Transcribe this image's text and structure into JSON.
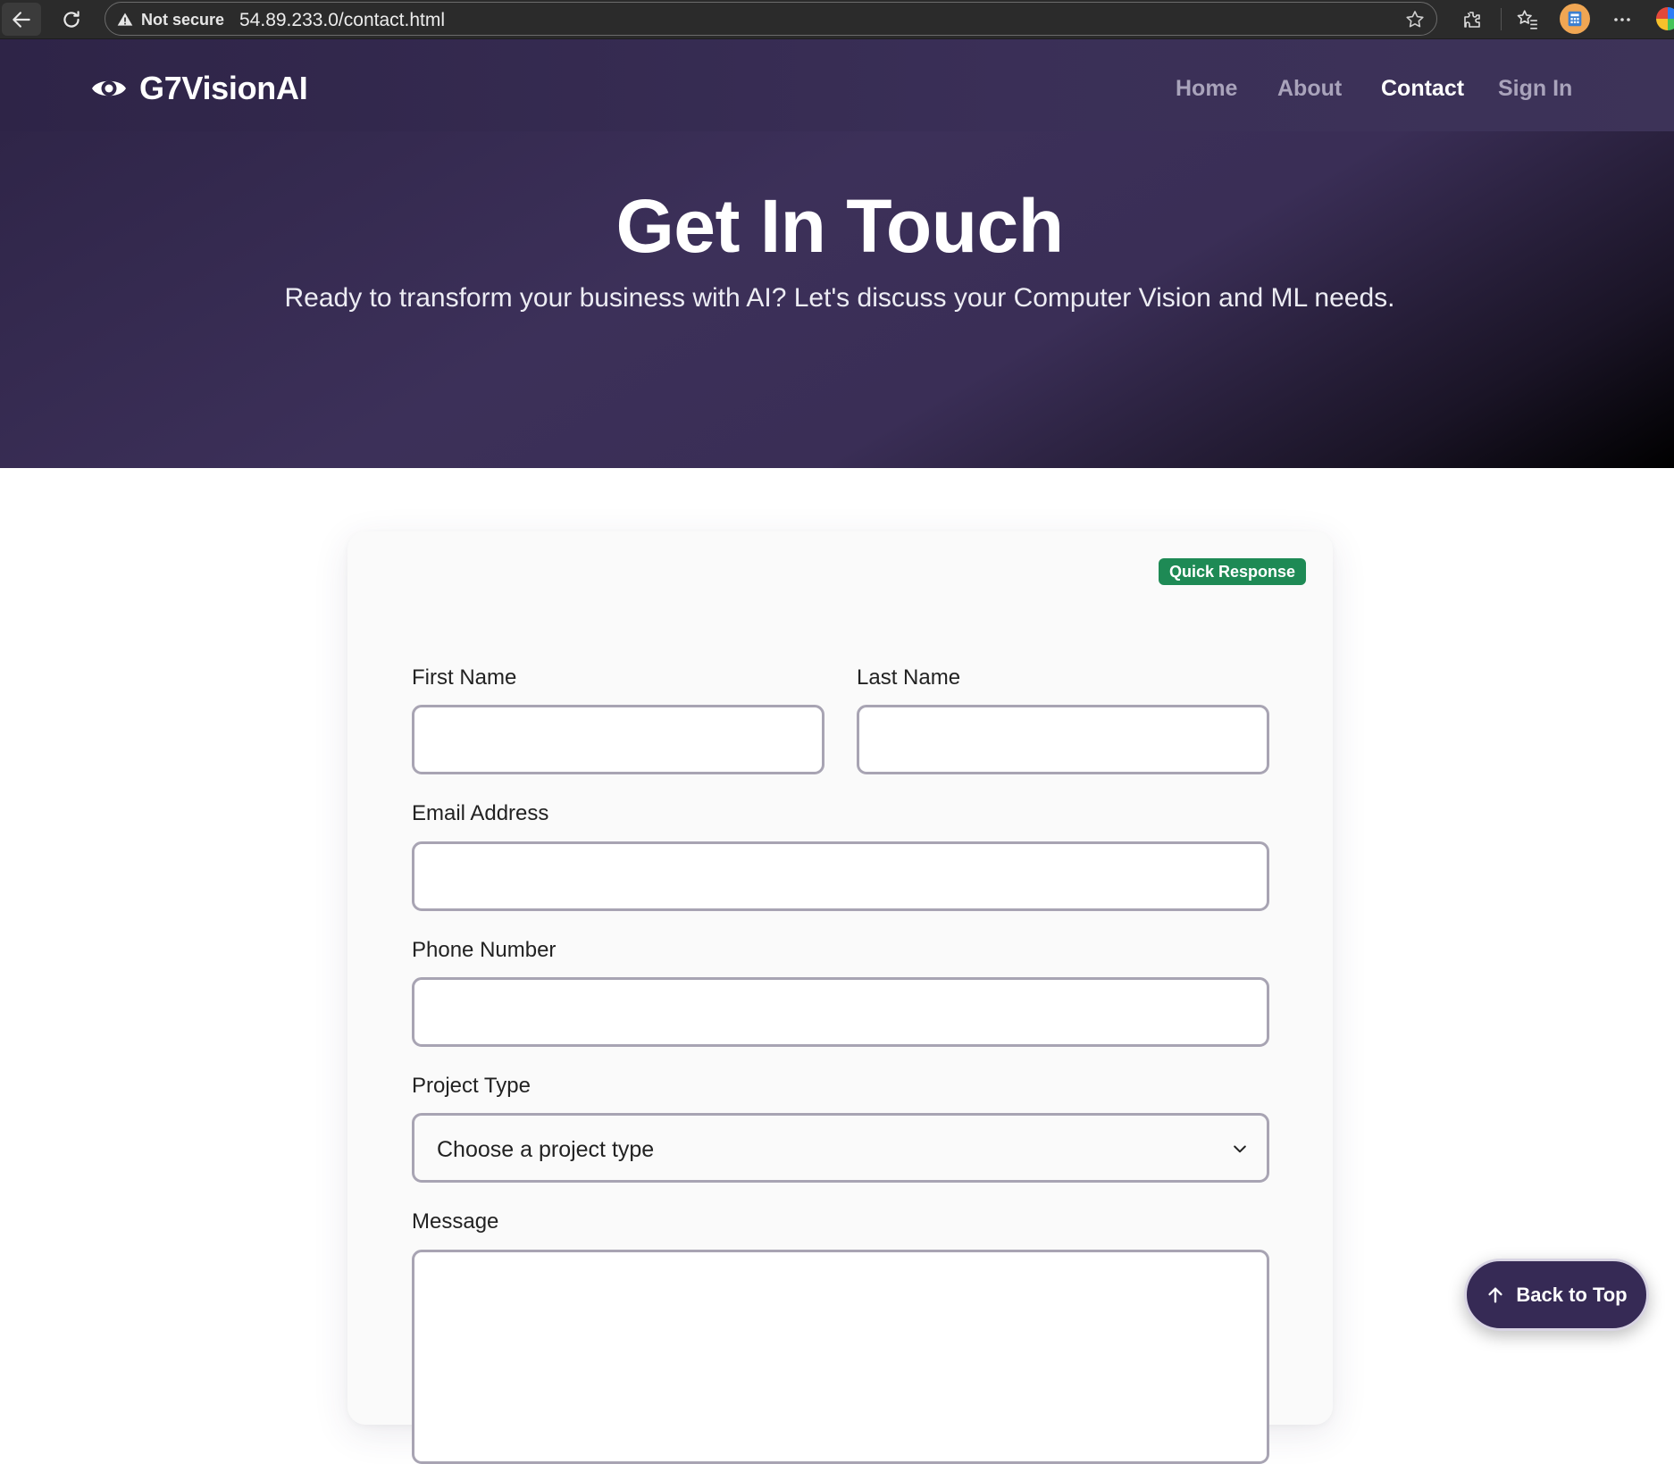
{
  "browser": {
    "security_label": "Not secure",
    "url": "54.89.233.0/contact.html"
  },
  "nav": {
    "brand": "G7VisionAI",
    "links": [
      {
        "label": "Home",
        "active": false
      },
      {
        "label": "About",
        "active": false
      },
      {
        "label": "Contact",
        "active": true
      },
      {
        "label": "Sign In",
        "active": false
      }
    ]
  },
  "hero": {
    "title": "Get In Touch",
    "subtitle": "Ready to transform your business with AI? Let's discuss your Computer Vision and ML needs."
  },
  "form": {
    "badge": "Quick Response",
    "first_name_label": "First Name",
    "first_name_value": "",
    "last_name_label": "Last Name",
    "last_name_value": "",
    "email_label": "Email Address",
    "email_value": "",
    "phone_label": "Phone Number",
    "phone_value": "",
    "project_type_label": "Project Type",
    "project_type_selected": "Choose a project type",
    "message_label": "Message",
    "message_value": ""
  },
  "back_to_top": "Back to Top",
  "colors": {
    "nav_bg": "#2e2447",
    "accent_purple": "#362a55",
    "badge_green": "#1e8a55"
  }
}
